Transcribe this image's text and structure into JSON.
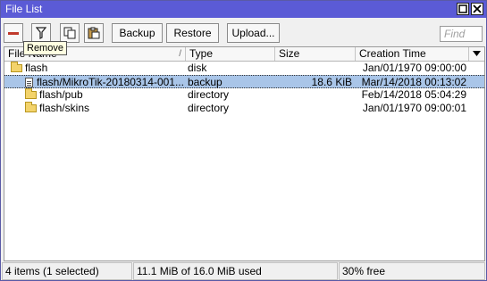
{
  "window": {
    "title": "File List"
  },
  "toolbar": {
    "backup_label": "Backup",
    "restore_label": "Restore",
    "upload_label": "Upload...",
    "find_placeholder": "Find",
    "remove_tooltip": "Remove"
  },
  "columns": {
    "name": "File Name",
    "sort_marker": "/",
    "type": "Type",
    "size": "Size",
    "creation_time": "Creation Time"
  },
  "rows": [
    {
      "name": "flash",
      "type": "disk",
      "size": "",
      "time": "Jan/01/1970 09:00:00",
      "icon": "folder-icon"
    },
    {
      "name": "flash/MikroTik-20180314-001...",
      "type": "backup",
      "size": "18.6 KiB",
      "time": "Mar/14/2018 00:13:02",
      "icon": "file-icon",
      "selected": true
    },
    {
      "name": "flash/pub",
      "type": "directory",
      "size": "",
      "time": "Feb/14/2018 05:04:29",
      "icon": "folder-icon"
    },
    {
      "name": "flash/skins",
      "type": "directory",
      "size": "",
      "time": "Jan/01/1970 09:00:01",
      "icon": "folder-icon"
    }
  ],
  "status": {
    "items": "4 items (1 selected)",
    "usage": "11.1 MiB of 16.0 MiB used",
    "free": "30% free"
  },
  "colors": {
    "titlebar": "#5b5bd6",
    "selection": "#a9c5e8",
    "remove_icon": "#c0392b"
  }
}
